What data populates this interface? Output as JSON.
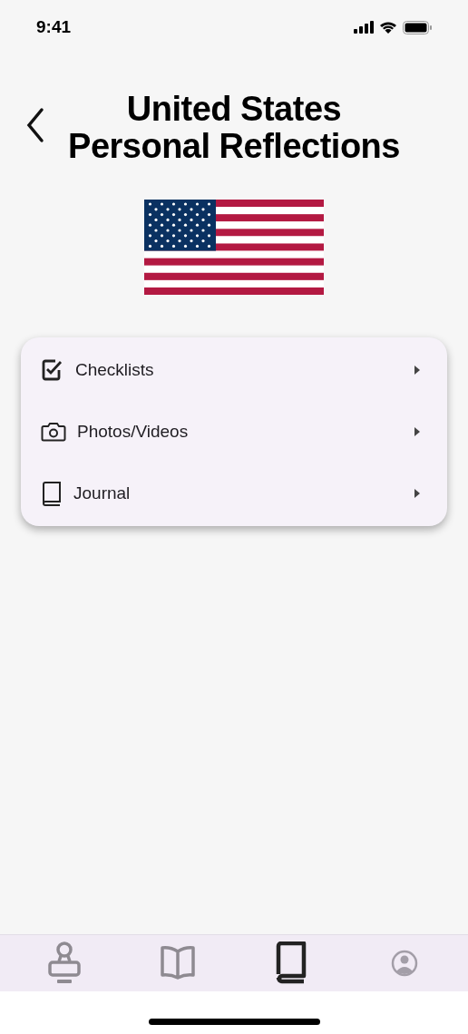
{
  "status_bar": {
    "time": "9:41"
  },
  "header": {
    "title_lines": [
      "United States",
      "Personal Reflections"
    ]
  },
  "menu": [
    {
      "kind": "checklist",
      "label": "Checklists"
    },
    {
      "kind": "camera",
      "label": "Photos/Videos"
    },
    {
      "kind": "book",
      "label": "Journal"
    }
  ],
  "tab_bar": [
    {
      "kind": "stamp",
      "selected": false
    },
    {
      "kind": "open-book",
      "selected": false
    },
    {
      "kind": "book",
      "selected": true
    },
    {
      "kind": "profile",
      "selected": false
    }
  ]
}
